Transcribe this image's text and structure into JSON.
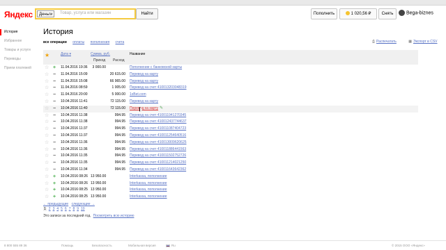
{
  "header": {
    "logo": "Яндекс",
    "search_scope": "Деньги",
    "search_placeholder": "Товар, услуга или магазин",
    "search_button": "Найти",
    "topup_button": "Пополнить",
    "balance": "1 020,56 ₽",
    "withdraw_button": "Снять",
    "username": "Bega-biznes"
  },
  "sidebar": {
    "items": [
      {
        "label": "История"
      },
      {
        "label": "Избранное"
      },
      {
        "label": "Товары и услуги"
      },
      {
        "label": "Переводы"
      },
      {
        "label": "Прием платежей"
      }
    ]
  },
  "page": {
    "title": "История",
    "filters": [
      "все операции",
      "оплаты",
      "пополнения",
      "счета"
    ],
    "print_link": "Распечатать",
    "export_link": "Экспорт в CSV"
  },
  "table": {
    "headers": {
      "date": "Дата",
      "sum": "Сумма, руб.",
      "income": "Приход",
      "expense": "Расход",
      "name": "Название"
    },
    "rows": [
      {
        "type": "in",
        "date": "11.04.2016 19:36",
        "income": "3 000.00",
        "expense": "",
        "name": "Пополнение с банковской карты"
      },
      {
        "type": "out",
        "date": "11.04.2016 15:09",
        "income": "",
        "expense": "20 615.00",
        "name": "Перевод на карту"
      },
      {
        "type": "out",
        "date": "11.04.2016 15:08",
        "income": "",
        "expense": "66 965.00",
        "name": "Перевод на карту"
      },
      {
        "type": "out",
        "date": "11.04.2016 08:59",
        "income": "",
        "expense": "1 005.00",
        "name": "Перевод на счет 410013203048319"
      },
      {
        "type": "out",
        "date": "11.04.2016 20:00",
        "income": "",
        "expense": "5 000.00",
        "name": "1xBet.com"
      },
      {
        "type": "out",
        "date": "10.04.2016 11:41",
        "income": "",
        "expense": "72 115.00",
        "name": "Перевод на карту"
      },
      {
        "type": "out",
        "date": "10.04.2016 11:40",
        "income": "",
        "expense": "72 115.00",
        "name": "Перевод на карту",
        "highlight": true
      },
      {
        "type": "out",
        "date": "10.04.2016 11:38",
        "income": "",
        "expense": "994.95",
        "name": "Перевод на счет 410011941270345"
      },
      {
        "type": "out",
        "date": "10.04.2016 11:38",
        "income": "",
        "expense": "994.95",
        "name": "Перевод на счет 410012437744637"
      },
      {
        "type": "out",
        "date": "10.04.2016 11:37",
        "income": "",
        "expense": "994.95",
        "name": "Перевод на счет 410011087404723"
      },
      {
        "type": "out",
        "date": "10.04.2016 11:37",
        "income": "",
        "expense": "994.95",
        "name": "Перевод на счет 410011254640516"
      },
      {
        "type": "out",
        "date": "10.04.2016 11:36",
        "income": "",
        "expense": "994.95",
        "name": "Перевод на счет 410013009620625"
      },
      {
        "type": "out",
        "date": "10.04.2016 11:36",
        "income": "",
        "expense": "994.95",
        "name": "Перевод на счет 410011886441563"
      },
      {
        "type": "out",
        "date": "10.04.2016 11:35",
        "income": "",
        "expense": "994.95",
        "name": "Перевод на счет 410011502752726"
      },
      {
        "type": "out",
        "date": "10.04.2016 11:35",
        "income": "",
        "expense": "994.95",
        "name": "Перевод на счет 410011214021250"
      },
      {
        "type": "out",
        "date": "10.04.2016 11:34",
        "income": "",
        "expense": "994.95",
        "name": "Перевод на счет 410011643642362"
      },
      {
        "type": "in",
        "date": "10.04.2016 08:26",
        "income": "13 950.00",
        "expense": "",
        "name": "Interkassa, пополнение"
      },
      {
        "type": "in",
        "date": "10.04.2016 08:26",
        "income": "13 950.00",
        "expense": "",
        "name": "Interkassa, пополнение"
      },
      {
        "type": "in",
        "date": "10.04.2016 08:25",
        "income": "13 950.00",
        "expense": "",
        "name": "Interkassa, пополнение"
      },
      {
        "type": "in",
        "date": "10.04.2016 08:25",
        "income": "13 950.00",
        "expense": "",
        "name": "Interkassa, пополнение"
      }
    ]
  },
  "pager": {
    "prev": "← предыдущие",
    "next": "следующие →",
    "pages": [
      "1",
      "2",
      "3",
      "4",
      "5",
      "6",
      "7",
      "8",
      "9",
      "10"
    ],
    "current_page": "1"
  },
  "note": {
    "text": "Это записи за последний год.",
    "link": "Посмотреть всю историю"
  },
  "footer": {
    "phone": "8 800 555 89 36",
    "help": "Помощь",
    "security": "Безопасность",
    "mobile": "Мобильная версия",
    "lang": "Ru",
    "copyright": "© 2015 ООО «Яндекс»"
  },
  "colors": {
    "brand_red": "#ff0000",
    "link": "#5570c4",
    "income_plus": "#4caf50",
    "search_border": "#f5cb40"
  }
}
